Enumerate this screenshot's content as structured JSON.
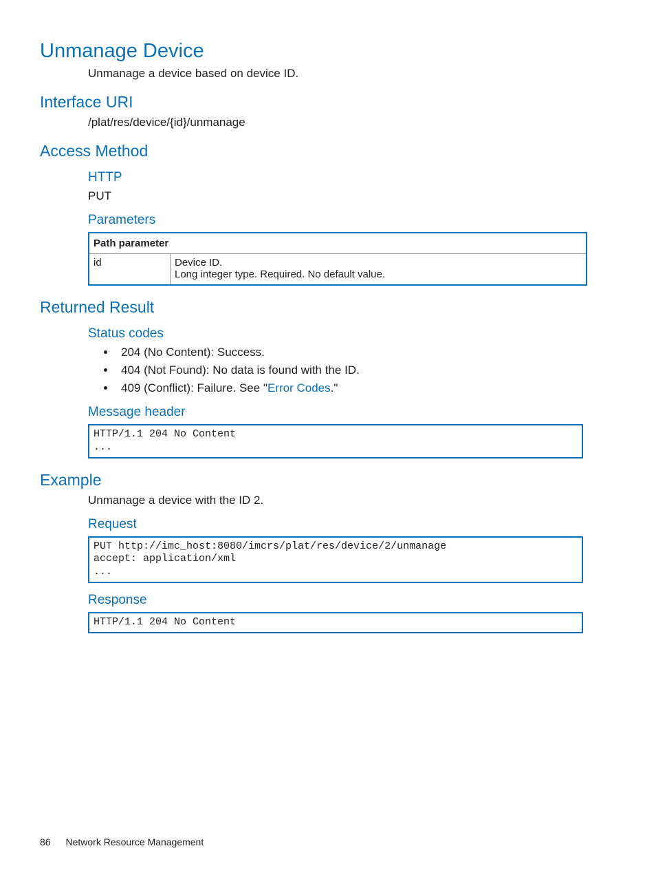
{
  "title": "Unmanage Device",
  "intro": "Unmanage a device based on device ID.",
  "interface_uri": {
    "heading": "Interface URI",
    "value": "/plat/res/device/{id}/unmanage"
  },
  "access_method": {
    "heading": "Access Method",
    "http_heading": "HTTP",
    "http_value": "PUT",
    "parameters_heading": "Parameters",
    "table": {
      "header": "Path parameter",
      "param_name": "id",
      "desc_line1": "Device ID.",
      "desc_line2": "Long integer type. Required. No default value."
    }
  },
  "returned_result": {
    "heading": "Returned Result",
    "status_heading": "Status codes",
    "status": {
      "i0": "204 (No Content): Success.",
      "i1": "404 (Not Found): No data is found with the ID.",
      "i2_prefix": "409 (Conflict): Failure. See \"",
      "i2_link": "Error Codes",
      "i2_suffix": ".\""
    },
    "message_header_heading": "Message header",
    "message_header_code": "HTTP/1.1 204 No Content\n..."
  },
  "example": {
    "heading": "Example",
    "intro": "Unmanage a device with the ID 2.",
    "request_heading": "Request",
    "request_code": "PUT http://imc_host:8080/imcrs/plat/res/device/2/unmanage\naccept: application/xml\n...",
    "response_heading": "Response",
    "response_code": "HTTP/1.1 204 No Content"
  },
  "footer": {
    "page_number": "86",
    "section": "Network Resource Management"
  }
}
